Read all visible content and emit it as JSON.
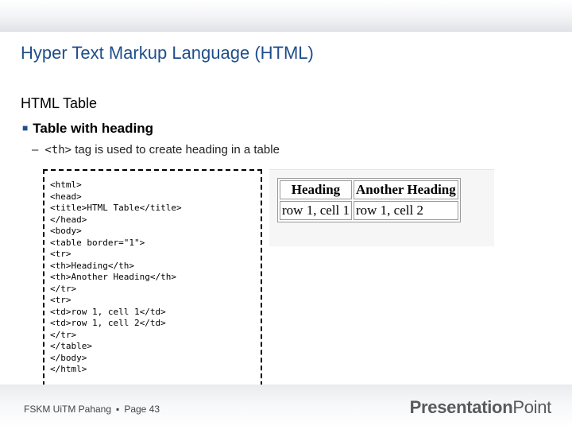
{
  "slide": {
    "title": "Hyper Text Markup Language (HTML)",
    "subtitle": "HTML Table",
    "bullet": "Table with heading",
    "subbullet": {
      "dash": "–",
      "code": "<th>",
      "text": " tag is used to create heading in a table"
    }
  },
  "code_lines": [
    "<html>",
    "<head>",
    "<title>HTML Table</title>",
    "</head>",
    "<body>",
    "<table border=\"1\">",
    "<tr>",
    "<th>Heading</th>",
    "<th>Another Heading</th>",
    "</tr>",
    "<tr>",
    "<td>row 1, cell 1</td>",
    "<td>row 1, cell 2</td>",
    "</tr>",
    "</table>",
    "</body>",
    "</html>"
  ],
  "preview_table": {
    "headers": [
      "Heading",
      "Another Heading"
    ],
    "rows": [
      [
        "row 1, cell 1",
        "row 1, cell 2"
      ]
    ]
  },
  "footer": {
    "org": "FSKM UiTM Pahang",
    "separator": "▪",
    "page": "Page 43"
  },
  "logo": {
    "part1": "Presentation",
    "part2": "Point"
  },
  "colors": {
    "title": "#1f4e8c",
    "bullet_marker": "#1f4e8c"
  }
}
